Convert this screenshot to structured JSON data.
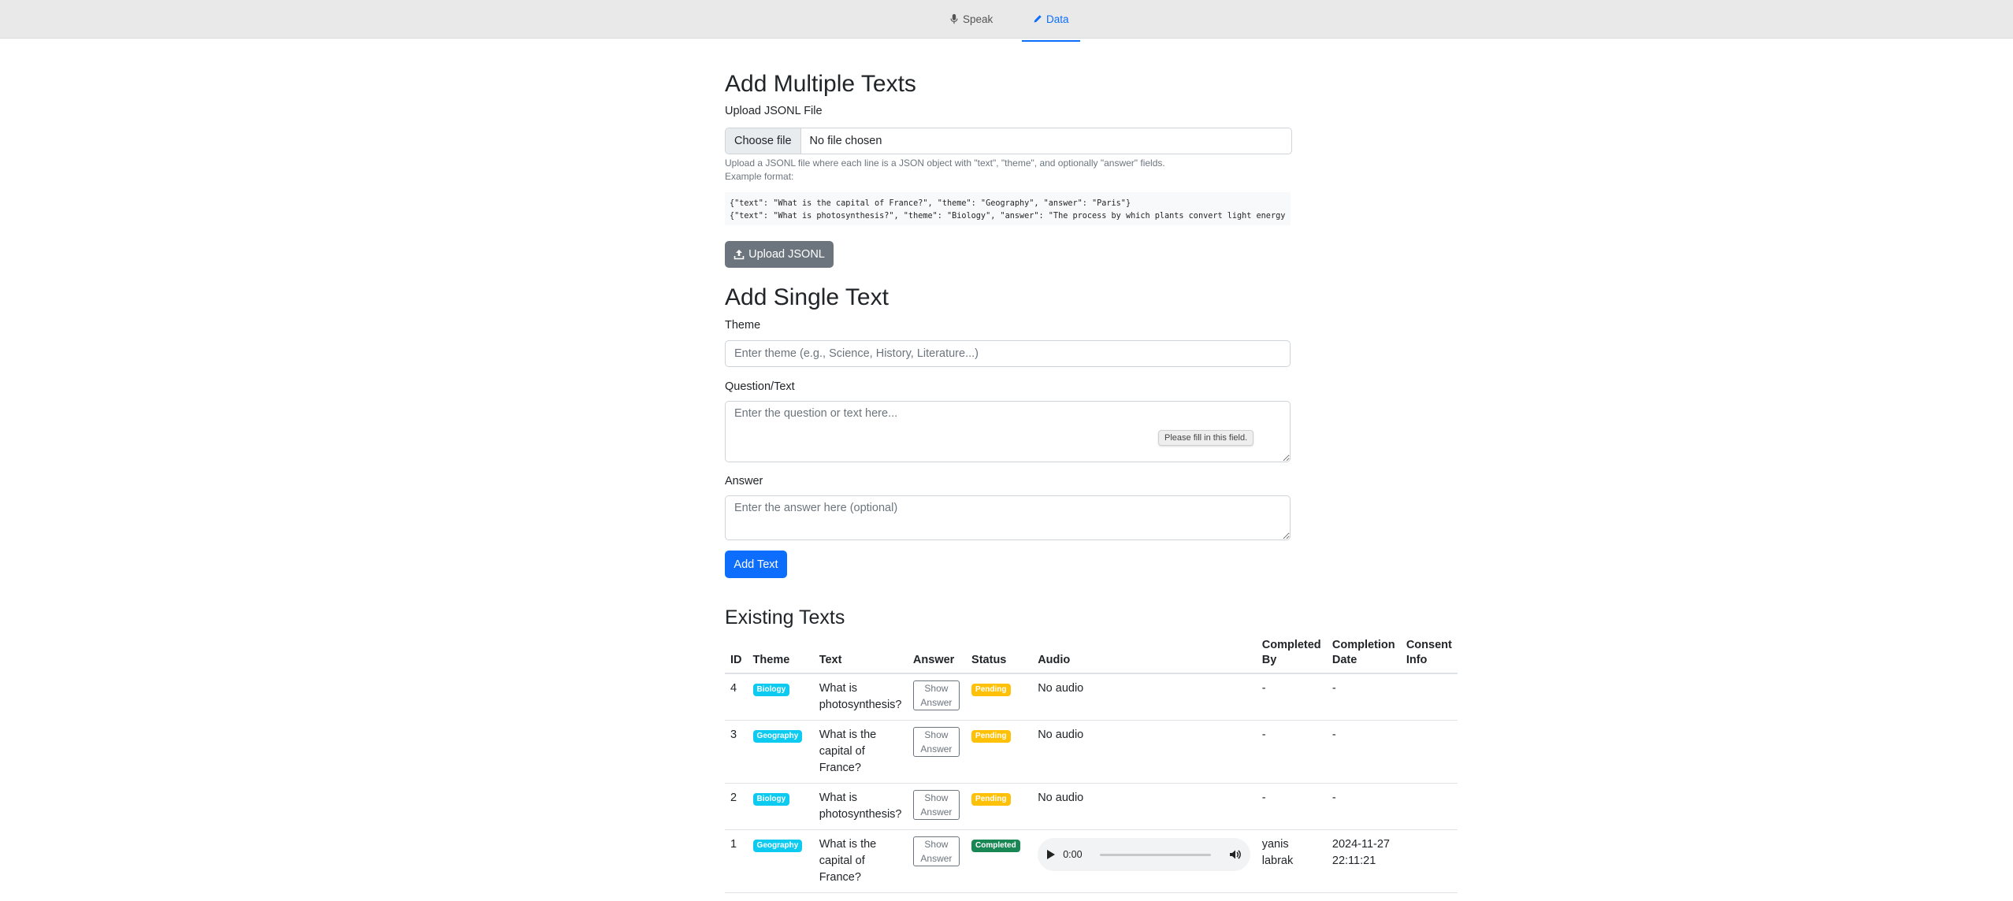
{
  "nav": {
    "tabs": [
      {
        "label": "Speak",
        "icon": "mic-icon",
        "active": false
      },
      {
        "label": "Data",
        "icon": "pencil-icon",
        "active": true
      }
    ],
    "accent": "#0d6efd"
  },
  "multi": {
    "title": "Add Multiple Texts",
    "file_label": "Upload JSONL File",
    "choose_button": "Choose file",
    "file_name": "No file chosen",
    "help_line1": "Upload a JSONL file where each line is a JSON object with \"text\", \"theme\", and optionally \"answer\" fields.",
    "help_line2": "Example format:",
    "example_line1": "{\"text\": \"What is the capital of France?\", \"theme\": \"Geography\", \"answer\": \"Paris\"}",
    "example_line2": "{\"text\": \"What is photosynthesis?\", \"theme\": \"Biology\", \"answer\": \"The process by which plants convert light energy into chemical energy\"}",
    "upload_button": "Upload JSONL"
  },
  "single": {
    "title": "Add Single Text",
    "theme_label": "Theme",
    "theme_placeholder": "Enter theme (e.g., Science, History, Literature...)",
    "question_label": "Question/Text",
    "question_placeholder": "Enter the question or text here...",
    "validation_tooltip": "Please fill in this field.",
    "answer_label": "Answer",
    "answer_placeholder": "Enter the answer here (optional)",
    "add_button": "Add Text"
  },
  "existing": {
    "title": "Existing Texts",
    "columns": [
      "ID",
      "Theme",
      "Text",
      "Answer",
      "Status",
      "Audio",
      "Completed By",
      "Completion Date",
      "Consent Info"
    ],
    "show_answer_label": "Show Answer",
    "rows": [
      {
        "id": "4",
        "theme": "Biology",
        "text": "What is photosynthesis?",
        "status": "Pending",
        "audio": "No audio",
        "completed_by": "-",
        "completion_date": "-",
        "consent": ""
      },
      {
        "id": "3",
        "theme": "Geography",
        "text": "What is the capital of France?",
        "status": "Pending",
        "audio": "No audio",
        "completed_by": "-",
        "completion_date": "-",
        "consent": ""
      },
      {
        "id": "2",
        "theme": "Biology",
        "text": "What is photosynthesis?",
        "status": "Pending",
        "audio": "No audio",
        "completed_by": "-",
        "completion_date": "-",
        "consent": ""
      },
      {
        "id": "1",
        "theme": "Geography",
        "text": "What is the capital of France?",
        "status": "Completed",
        "audio_time": "0:00",
        "completed_by": "yanis labrak",
        "completion_date": "2024-11-27 22:11:21",
        "consent": ""
      }
    ]
  }
}
